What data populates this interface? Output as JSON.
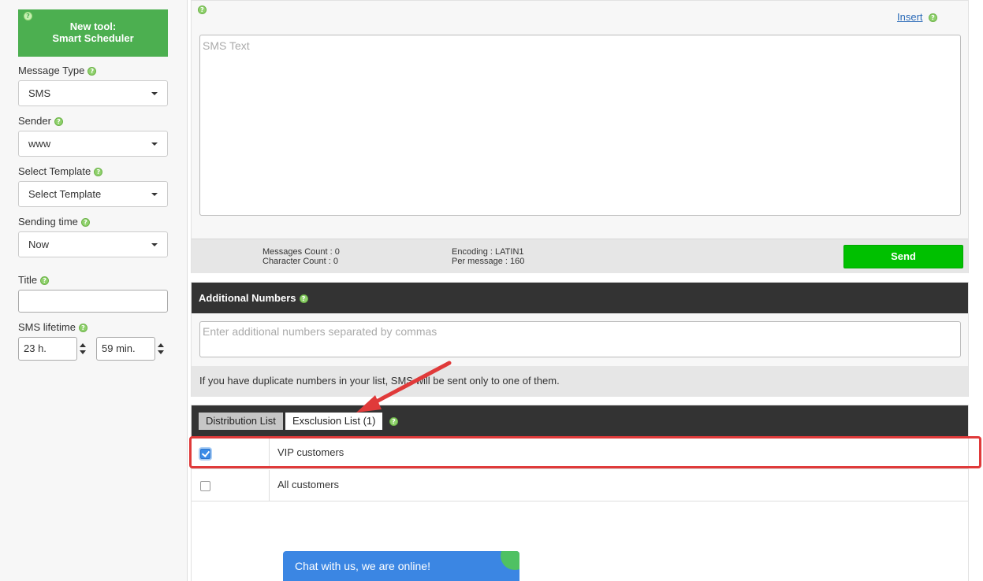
{
  "sidebar": {
    "promo": {
      "line1": "New tool:",
      "line2": "Smart Scheduler"
    },
    "message_type": {
      "label": "Message Type",
      "value": "SMS"
    },
    "sender": {
      "label": "Sender",
      "value": "www"
    },
    "template": {
      "label": "Select Template",
      "value": "Select Template"
    },
    "sending_time": {
      "label": "Sending time",
      "value": "Now"
    },
    "title": {
      "label": "Title",
      "value": ""
    },
    "lifetime": {
      "label": "SMS lifetime",
      "hours": "23 h.",
      "minutes": "59 min."
    }
  },
  "sms": {
    "insert_label": "Insert",
    "placeholder": "SMS Text",
    "messages_count": "Messages Count : 0",
    "character_count": "Character Count : 0",
    "encoding": "Encoding : LATIN1",
    "per_message": "Per message : 160",
    "send_label": "Send"
  },
  "additional_numbers": {
    "title": "Additional Numbers",
    "placeholder": "Enter additional numbers separated by commas",
    "duplicate_note": "If you have duplicate numbers in your list, SMS will be sent only to one of them."
  },
  "lists": {
    "tabs": [
      {
        "label": "Distribution List",
        "active": false
      },
      {
        "label": "Exsclusion List (1)",
        "active": true
      }
    ],
    "rows": [
      {
        "label": "VIP customers",
        "checked": true
      },
      {
        "label": "All customers",
        "checked": false
      }
    ]
  },
  "chat": {
    "label": "Chat with us, we are online!"
  },
  "colors": {
    "send": "#00c000",
    "promo": "#4caf50",
    "header": "#333333",
    "annotation": "#e03a3a",
    "chat": "#3b86e3"
  },
  "help_icon": "question-mark-circle-icon"
}
